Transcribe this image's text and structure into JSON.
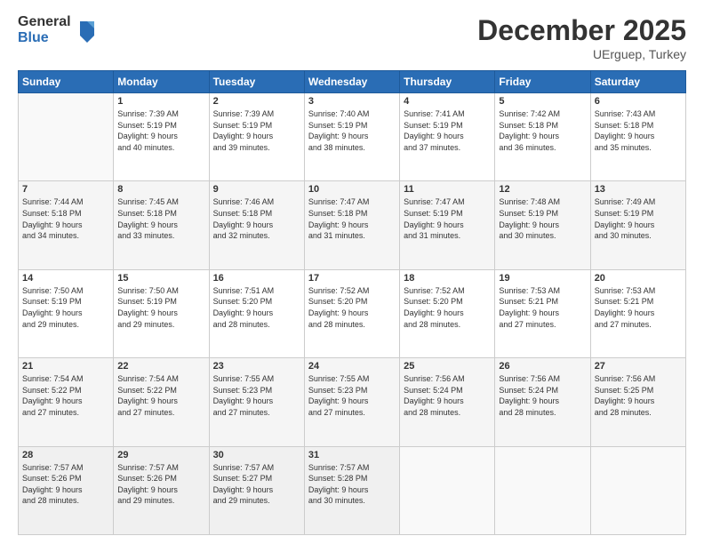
{
  "logo": {
    "general": "General",
    "blue": "Blue"
  },
  "header": {
    "title": "December 2025",
    "location": "UErguep, Turkey"
  },
  "days": [
    "Sunday",
    "Monday",
    "Tuesday",
    "Wednesday",
    "Thursday",
    "Friday",
    "Saturday"
  ],
  "weeks": [
    [
      {
        "day": "",
        "info": ""
      },
      {
        "day": "1",
        "info": "Sunrise: 7:39 AM\nSunset: 5:19 PM\nDaylight: 9 hours\nand 40 minutes."
      },
      {
        "day": "2",
        "info": "Sunrise: 7:39 AM\nSunset: 5:19 PM\nDaylight: 9 hours\nand 39 minutes."
      },
      {
        "day": "3",
        "info": "Sunrise: 7:40 AM\nSunset: 5:19 PM\nDaylight: 9 hours\nand 38 minutes."
      },
      {
        "day": "4",
        "info": "Sunrise: 7:41 AM\nSunset: 5:19 PM\nDaylight: 9 hours\nand 37 minutes."
      },
      {
        "day": "5",
        "info": "Sunrise: 7:42 AM\nSunset: 5:18 PM\nDaylight: 9 hours\nand 36 minutes."
      },
      {
        "day": "6",
        "info": "Sunrise: 7:43 AM\nSunset: 5:18 PM\nDaylight: 9 hours\nand 35 minutes."
      }
    ],
    [
      {
        "day": "7",
        "info": "Sunrise: 7:44 AM\nSunset: 5:18 PM\nDaylight: 9 hours\nand 34 minutes."
      },
      {
        "day": "8",
        "info": "Sunrise: 7:45 AM\nSunset: 5:18 PM\nDaylight: 9 hours\nand 33 minutes."
      },
      {
        "day": "9",
        "info": "Sunrise: 7:46 AM\nSunset: 5:18 PM\nDaylight: 9 hours\nand 32 minutes."
      },
      {
        "day": "10",
        "info": "Sunrise: 7:47 AM\nSunset: 5:18 PM\nDaylight: 9 hours\nand 31 minutes."
      },
      {
        "day": "11",
        "info": "Sunrise: 7:47 AM\nSunset: 5:19 PM\nDaylight: 9 hours\nand 31 minutes."
      },
      {
        "day": "12",
        "info": "Sunrise: 7:48 AM\nSunset: 5:19 PM\nDaylight: 9 hours\nand 30 minutes."
      },
      {
        "day": "13",
        "info": "Sunrise: 7:49 AM\nSunset: 5:19 PM\nDaylight: 9 hours\nand 30 minutes."
      }
    ],
    [
      {
        "day": "14",
        "info": "Sunrise: 7:50 AM\nSunset: 5:19 PM\nDaylight: 9 hours\nand 29 minutes."
      },
      {
        "day": "15",
        "info": "Sunrise: 7:50 AM\nSunset: 5:19 PM\nDaylight: 9 hours\nand 29 minutes."
      },
      {
        "day": "16",
        "info": "Sunrise: 7:51 AM\nSunset: 5:20 PM\nDaylight: 9 hours\nand 28 minutes."
      },
      {
        "day": "17",
        "info": "Sunrise: 7:52 AM\nSunset: 5:20 PM\nDaylight: 9 hours\nand 28 minutes."
      },
      {
        "day": "18",
        "info": "Sunrise: 7:52 AM\nSunset: 5:20 PM\nDaylight: 9 hours\nand 28 minutes."
      },
      {
        "day": "19",
        "info": "Sunrise: 7:53 AM\nSunset: 5:21 PM\nDaylight: 9 hours\nand 27 minutes."
      },
      {
        "day": "20",
        "info": "Sunrise: 7:53 AM\nSunset: 5:21 PM\nDaylight: 9 hours\nand 27 minutes."
      }
    ],
    [
      {
        "day": "21",
        "info": "Sunrise: 7:54 AM\nSunset: 5:22 PM\nDaylight: 9 hours\nand 27 minutes."
      },
      {
        "day": "22",
        "info": "Sunrise: 7:54 AM\nSunset: 5:22 PM\nDaylight: 9 hours\nand 27 minutes."
      },
      {
        "day": "23",
        "info": "Sunrise: 7:55 AM\nSunset: 5:23 PM\nDaylight: 9 hours\nand 27 minutes."
      },
      {
        "day": "24",
        "info": "Sunrise: 7:55 AM\nSunset: 5:23 PM\nDaylight: 9 hours\nand 27 minutes."
      },
      {
        "day": "25",
        "info": "Sunrise: 7:56 AM\nSunset: 5:24 PM\nDaylight: 9 hours\nand 28 minutes."
      },
      {
        "day": "26",
        "info": "Sunrise: 7:56 AM\nSunset: 5:24 PM\nDaylight: 9 hours\nand 28 minutes."
      },
      {
        "day": "27",
        "info": "Sunrise: 7:56 AM\nSunset: 5:25 PM\nDaylight: 9 hours\nand 28 minutes."
      }
    ],
    [
      {
        "day": "28",
        "info": "Sunrise: 7:57 AM\nSunset: 5:26 PM\nDaylight: 9 hours\nand 28 minutes."
      },
      {
        "day": "29",
        "info": "Sunrise: 7:57 AM\nSunset: 5:26 PM\nDaylight: 9 hours\nand 29 minutes."
      },
      {
        "day": "30",
        "info": "Sunrise: 7:57 AM\nSunset: 5:27 PM\nDaylight: 9 hours\nand 29 minutes."
      },
      {
        "day": "31",
        "info": "Sunrise: 7:57 AM\nSunset: 5:28 PM\nDaylight: 9 hours\nand 30 minutes."
      },
      {
        "day": "",
        "info": ""
      },
      {
        "day": "",
        "info": ""
      },
      {
        "day": "",
        "info": ""
      }
    ]
  ]
}
